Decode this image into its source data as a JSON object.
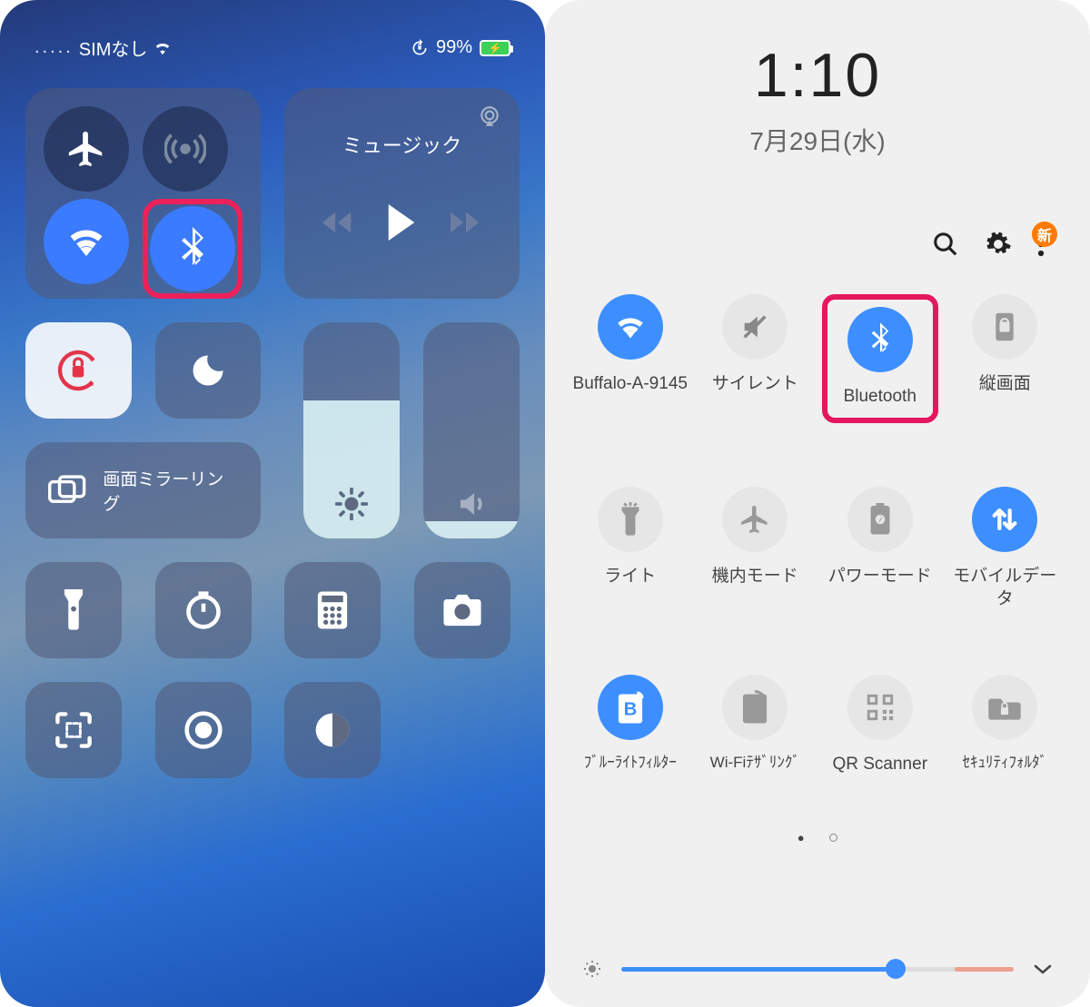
{
  "ios": {
    "status": {
      "carrier": "SIMなし",
      "battery_pct": "99%"
    },
    "music": {
      "title": "ミュージック"
    },
    "mirror_label": "画面ミラーリング",
    "brightness_fill_pct": 64,
    "volume_fill_pct": 8
  },
  "android": {
    "time": "1:10",
    "date": "7月29日(水)",
    "badge": "新",
    "tiles": [
      {
        "label": "Buffalo-A-9145",
        "on": true
      },
      {
        "label": "サイレント",
        "on": false
      },
      {
        "label": "Bluetooth",
        "on": true
      },
      {
        "label": "縦画面",
        "on": false
      },
      {
        "label": "ライト",
        "on": false
      },
      {
        "label": "機内モード",
        "on": false
      },
      {
        "label": "パワーモード",
        "on": false
      },
      {
        "label": "モバイルデータ",
        "on": true
      },
      {
        "label": "ﾌﾞﾙｰﾗｲﾄﾌｨﾙﾀｰ",
        "on": true
      },
      {
        "label": "Wi-Fiﾃｻﾞﾘﾝｸﾞ",
        "on": false
      },
      {
        "label": "QR Scanner",
        "on": false
      },
      {
        "label": "ｾｷｭﾘﾃｨﾌｫﾙﾀﾞ",
        "on": false
      }
    ],
    "brightness_pct": 70,
    "colors": {
      "accent": "#3d8fff",
      "highlight": "#e4175f"
    }
  }
}
